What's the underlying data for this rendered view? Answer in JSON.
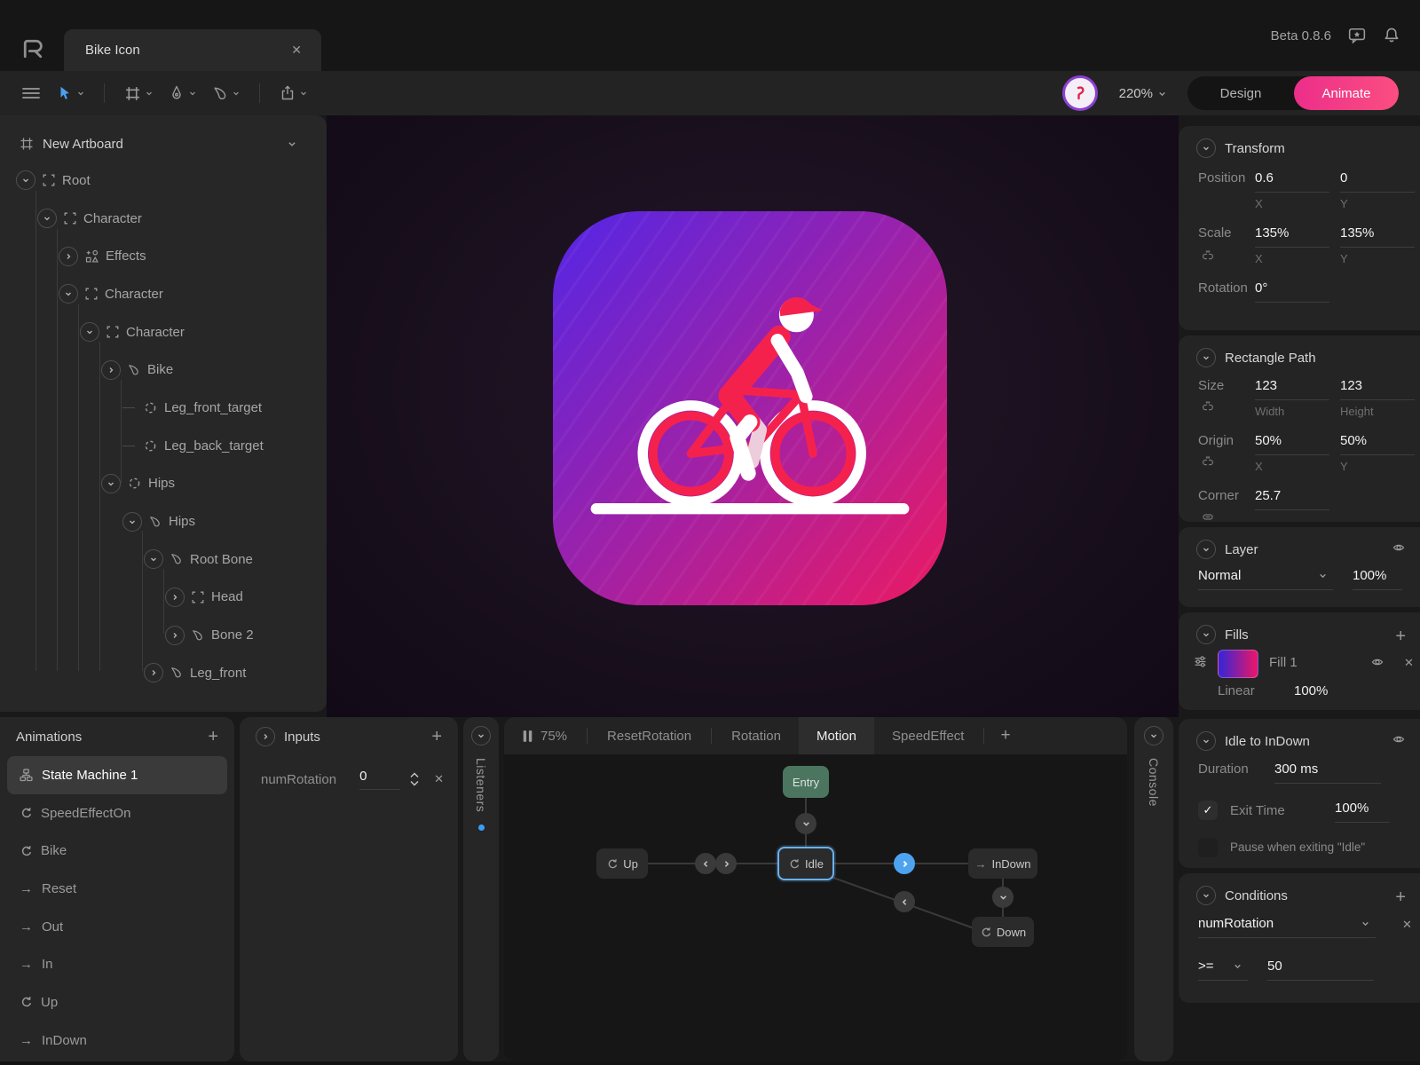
{
  "header": {
    "tab_title": "Bike Icon",
    "beta": "Beta 0.8.6"
  },
  "toolbar": {
    "zoom": "220%",
    "design": "Design",
    "animate": "Animate"
  },
  "icons": {
    "close": "✕",
    "plus": "+",
    "check": "✓",
    "oneshot": "→"
  },
  "hierarchy": {
    "artboard": "New Artboard",
    "items": [
      {
        "label": "Root",
        "indent": 0,
        "exp": "down",
        "icon": "group"
      },
      {
        "label": "Character",
        "indent": 1,
        "exp": "down",
        "icon": "group"
      },
      {
        "label": "Effects",
        "indent": 2,
        "exp": "right",
        "icon": "effects"
      },
      {
        "label": "Character",
        "indent": 2,
        "exp": "down",
        "icon": "group"
      },
      {
        "label": "Character",
        "indent": 3,
        "exp": "down",
        "icon": "group"
      },
      {
        "label": "Bike",
        "indent": 4,
        "exp": "right",
        "icon": "bone"
      },
      {
        "label": "Leg_front_target",
        "indent": 5,
        "exp": "none",
        "icon": "target"
      },
      {
        "label": "Leg_back_target",
        "indent": 5,
        "exp": "none",
        "icon": "target"
      },
      {
        "label": "Hips",
        "indent": 4,
        "exp": "down",
        "icon": "target"
      },
      {
        "label": "Hips",
        "indent": 5,
        "exp": "down",
        "icon": "bone"
      },
      {
        "label": "Root Bone",
        "indent": 6,
        "exp": "down",
        "icon": "bone"
      },
      {
        "label": "Head",
        "indent": 7,
        "exp": "right",
        "icon": "group"
      },
      {
        "label": "Bone 2",
        "indent": 7,
        "exp": "right",
        "icon": "bone"
      },
      {
        "label": "Leg_front",
        "indent": 6,
        "exp": "right",
        "icon": "bone"
      }
    ]
  },
  "animations": {
    "title": "Animations",
    "items": [
      {
        "label": "State Machine 1",
        "icon": "machine",
        "selected": true
      },
      {
        "label": "SpeedEffectOn",
        "icon": "loop",
        "selected": false
      },
      {
        "label": "Bike",
        "icon": "loop",
        "selected": false
      },
      {
        "label": "Reset",
        "icon": "oneshot",
        "selected": false
      },
      {
        "label": "Out",
        "icon": "oneshot",
        "selected": false
      },
      {
        "label": "In",
        "icon": "oneshot",
        "selected": false
      },
      {
        "label": "Up",
        "icon": "loop",
        "selected": false
      },
      {
        "label": "InDown",
        "icon": "oneshot",
        "selected": false
      }
    ]
  },
  "inputs": {
    "title": "Inputs",
    "rows": [
      {
        "name": "numRotation",
        "value": "0"
      }
    ]
  },
  "side_tabs": {
    "listeners": "Listeners",
    "console": "Console"
  },
  "machine": {
    "tabs": [
      {
        "label": "75%",
        "icon": "pause",
        "active": false
      },
      {
        "label": "ResetRotation",
        "icon": "",
        "active": false
      },
      {
        "label": "Rotation",
        "icon": "",
        "active": false
      },
      {
        "label": "Motion",
        "icon": "",
        "active": true
      },
      {
        "label": "SpeedEffect",
        "icon": "",
        "active": false
      }
    ],
    "nodes": {
      "entry": "Entry",
      "up": "Up",
      "idle": "Idle",
      "indown": "InDown",
      "down": "Down"
    }
  },
  "inspector": {
    "transform": {
      "title": "Transform",
      "position_label": "Position",
      "pos_x": "0.6",
      "pos_y": "0",
      "x_cap": "X",
      "y_cap": "Y",
      "scale_label": "Scale",
      "scale_x": "135%",
      "scale_y": "135%",
      "rotation_label": "Rotation",
      "rotation": "0°"
    },
    "rect": {
      "title": "Rectangle Path",
      "size_label": "Size",
      "w": "123",
      "h": "123",
      "w_cap": "Width",
      "h_cap": "Height",
      "origin_label": "Origin",
      "ox": "50%",
      "oy": "50%",
      "corner_label": "Corner",
      "corner": "25.7"
    },
    "layer": {
      "title": "Layer",
      "blend": "Normal",
      "opacity": "100%"
    },
    "fills": {
      "title": "Fills",
      "name": "Fill 1",
      "type": "Linear",
      "opacity": "100%"
    },
    "transition": {
      "title": "Idle to InDown",
      "duration_label": "Duration",
      "duration": "300 ms",
      "exit_label": "Exit Time",
      "exit": "100%",
      "pause_label": "Pause when exiting \"Idle\""
    },
    "conditions": {
      "title": "Conditions",
      "input": "numRotation",
      "op": ">=",
      "value": "50"
    }
  },
  "colors": {
    "accent_blue": "#4da3f0",
    "animate_pink": "#f23f87",
    "entry_green": "#4c7560",
    "icon_gradient_start": "#5326e6",
    "icon_gradient_end": "#ec1a62",
    "rider_red": "#f5214d"
  }
}
